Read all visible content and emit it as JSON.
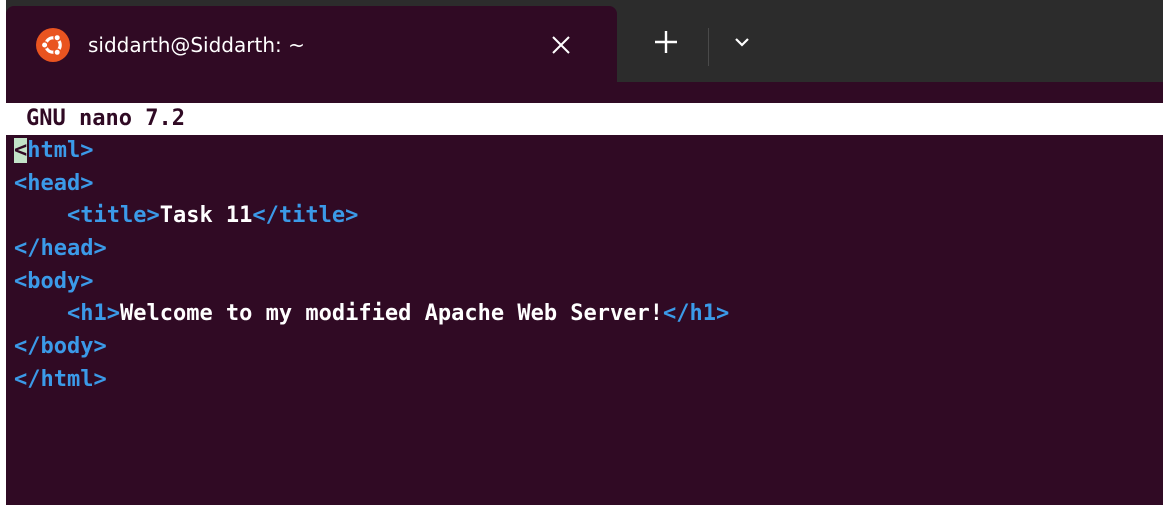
{
  "tab": {
    "title": "siddarth@Siddarth: ~",
    "icon": "ubuntu-logo-icon",
    "close_icon": "close-icon"
  },
  "tabbar": {
    "new_tab_icon": "plus-icon",
    "menu_icon": "chevron-down-icon"
  },
  "nano": {
    "header": "GNU nano 7.2"
  },
  "editor": {
    "lines": [
      {
        "cursor": "<",
        "tag_rest": "html>"
      },
      {
        "tag": "<head>"
      },
      {
        "indent": "    ",
        "open": "<title>",
        "text": "Task 11",
        "close": "</title>"
      },
      {
        "tag": "</head>"
      },
      {
        "tag": "<body>"
      },
      {
        "indent": "    ",
        "open": "<h1>",
        "text": "Welcome to my modified Apache Web Server!",
        "close": "</h1>"
      },
      {
        "tag": "</body>"
      },
      {
        "tag": "</html>"
      }
    ]
  },
  "colors": {
    "terminal_bg": "#300a24",
    "tab_bar_bg": "#2c2c2c",
    "tag_color": "#3b9ae8",
    "text_color": "#ffffff",
    "cursor_bg": "#c2e3c8",
    "ubuntu_orange": "#e95420"
  }
}
